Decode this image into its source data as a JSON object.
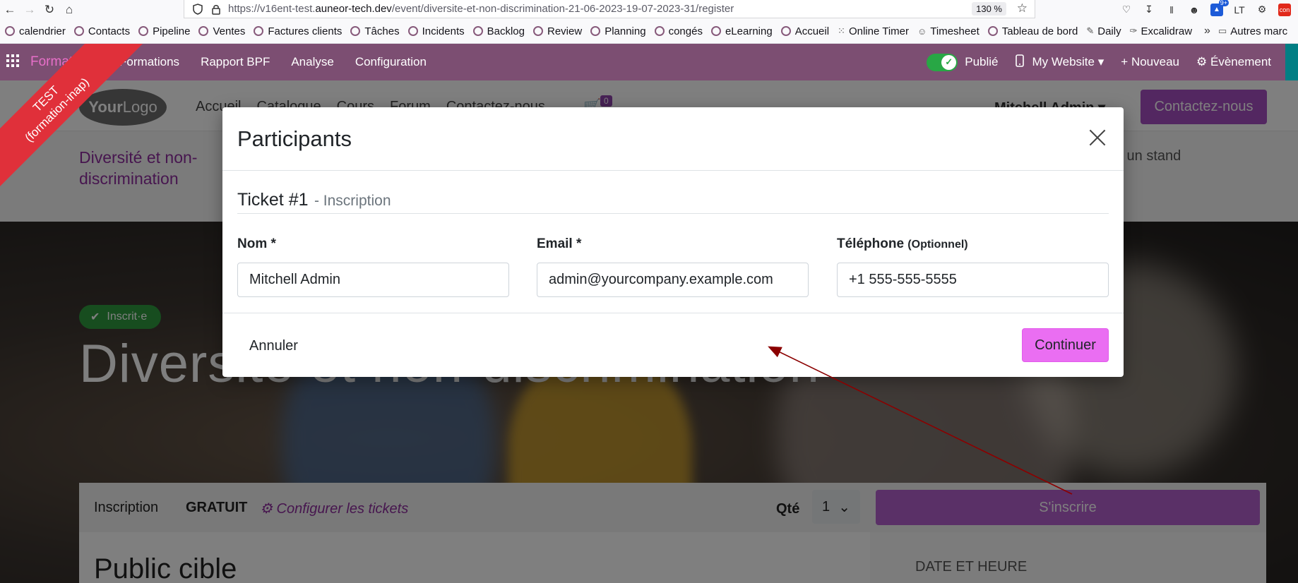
{
  "browser": {
    "url_prefix": "https://v16ent-test.",
    "url_domain": "auneor-tech.dev",
    "url_path": "/event/diversite-et-non-discrimination-21-06-2023-19-07-2023-31/register",
    "zoom": "130 %",
    "bookmarks": [
      {
        "label": "calendrier",
        "icon": "odoo-ring"
      },
      {
        "label": "Contacts",
        "icon": "odoo-ring"
      },
      {
        "label": "Pipeline",
        "icon": "odoo-ring"
      },
      {
        "label": "Ventes",
        "icon": "odoo-ring"
      },
      {
        "label": "Factures clients",
        "icon": "odoo-ring"
      },
      {
        "label": "Tâches",
        "icon": "odoo-ring"
      },
      {
        "label": "Incidents",
        "icon": "odoo-ring"
      },
      {
        "label": "Backlog",
        "icon": "odoo-ring"
      },
      {
        "label": "Review",
        "icon": "odoo-ring"
      },
      {
        "label": "Planning",
        "icon": "odoo-ring"
      },
      {
        "label": "congés",
        "icon": "odoo-ring"
      },
      {
        "label": "eLearning",
        "icon": "odoo-ring"
      },
      {
        "label": "Accueil",
        "icon": "odoo-ring"
      },
      {
        "label": "Online Timer",
        "icon": "dots-icon"
      },
      {
        "label": "Timesheet",
        "icon": "avatar-icon"
      },
      {
        "label": "Tableau de bord",
        "icon": "odoo-ring"
      },
      {
        "label": "Daily",
        "icon": "pen-icon"
      },
      {
        "label": "Excalidraw",
        "icon": "excalidraw-icon"
      }
    ],
    "bookmarks_more": "»",
    "other_bookmarks": "Autres marc",
    "toolbar_badge": "9+",
    "toolbar_lt": "LT",
    "toolbar_red": "con"
  },
  "odoo_nav": {
    "brand": "Formations",
    "items": [
      "Formations",
      "Rapport BPF",
      "Analyse",
      "Configuration"
    ],
    "published_label": "Publié",
    "website_label": "My Website",
    "new_label": "Nouveau",
    "event_label": "Évènement"
  },
  "ribbon": {
    "line1": "TEST",
    "line2": "(formation-inap)"
  },
  "site": {
    "logo_bold": "Your",
    "logo_light": "Logo",
    "menu": [
      "Accueil",
      "Catalogue",
      "Cours",
      "Forum",
      "Contactez-nous"
    ],
    "cart_count": "0",
    "user": "Mitchell Admin",
    "contact_button": "Contactez-nous",
    "event_title_small": "Diversité et non-discrimination",
    "right_link": "z un stand",
    "registered_badge": "Inscrit·e",
    "hero_title": "Diversité et non-discrimination",
    "reg_label": "Inscription",
    "price": "GRATUIT",
    "configure_tickets": "Configurer les tickets",
    "qty_label": "Qté",
    "qty_value": "1",
    "register_button": "S'inscrire",
    "public_title": "Public cible",
    "date_label": "DATE ET HEURE"
  },
  "modal": {
    "title": "Participants",
    "ticket_number": "Ticket #1",
    "ticket_type": "- Inscription",
    "fields": {
      "name_label": "Nom *",
      "name_value": "Mitchell Admin",
      "email_label": "Email *",
      "email_value": "admin@yourcompany.example.com",
      "phone_label": "Téléphone",
      "phone_optional": "(Optionnel)",
      "phone_value": "+1 555-555-5555"
    },
    "cancel_label": "Annuler",
    "continue_label": "Continuer"
  },
  "colors": {
    "odoo_nav": "#7c4e72",
    "accent_purple": "#8e2d9e",
    "continue_button": "#ea6ef2",
    "ribbon": "#e0303a",
    "annotation_arrow": "#8b0000"
  }
}
